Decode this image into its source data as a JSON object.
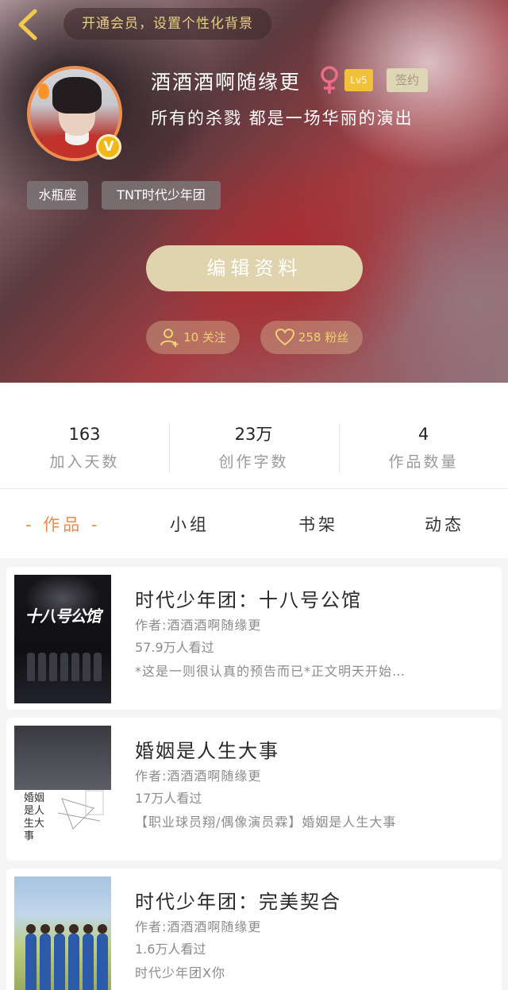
{
  "header": {
    "vip_banner": "开通会员，设置个性化背景",
    "username": "酒酒酒啊随缘更",
    "level": "Lv5",
    "sign_label": "签约",
    "avatar_badge": "V",
    "bio": "所有的杀戮 都是一场华丽的演出",
    "tags": [
      "水瓶座",
      "TNT时代少年团"
    ],
    "edit_button": "编辑资料",
    "following": "10 关注",
    "fans": "258 粉丝"
  },
  "stats": [
    {
      "value": "163",
      "label": "加入天数"
    },
    {
      "value": "23万",
      "label": "创作字数"
    },
    {
      "value": "4",
      "label": "作品数量"
    }
  ],
  "tabs": [
    "- 作品 -",
    "小组",
    "书架",
    "动态"
  ],
  "active_tab_color": "#e98b51",
  "books": [
    {
      "title": "时代少年团：十八号公馆",
      "author": "作者:酒酒酒啊随缘更",
      "views": "57.9万人看过",
      "description": "*这是一则很认真的预告而已*正文明天开始…",
      "cover_title": "十八号公馆"
    },
    {
      "title": "婚姻是人生大事",
      "author": "作者:酒酒酒啊随缘更",
      "views": "17万人看过",
      "description": "【职业球员翔/偶像演员霖】婚姻是人生大事",
      "cover_title": "婚姻是人生大事"
    },
    {
      "title": "时代少年团：完美契合",
      "author": "作者:酒酒酒啊随缘更",
      "views": "1.6万人看过",
      "description": "时代少年团X你"
    }
  ]
}
